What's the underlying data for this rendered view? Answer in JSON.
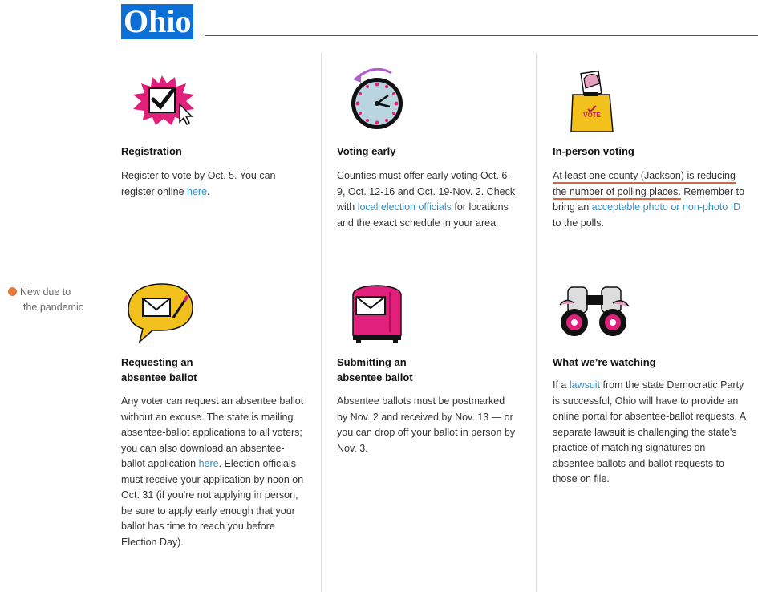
{
  "page": {
    "title": "Ohio"
  },
  "legend": {
    "line1": "New due to",
    "line2": "the pandemic",
    "dot_color": "#e87a3f",
    "icon": "orange-dot-icon"
  },
  "colors": {
    "title_bg": "#0b6fd6",
    "link": "#2f8fc6",
    "underline": "#e0603a",
    "pink": "#e0207a",
    "yellow": "#f3c11e"
  },
  "cards": {
    "registration": {
      "icon": "checkmark-starburst-icon",
      "heading": "Registration",
      "text1": "Register to vote by Oct. 5. You can register online ",
      "link": "here",
      "text2": "."
    },
    "early": {
      "icon": "clock-icon",
      "heading": "Voting early",
      "text1": "Counties must offer early voting Oct. 6-9, Oct. 12-16 and Oct. 19-Nov. 2. Check with ",
      "link": "local election officials",
      "text2": " for locations and the exact schedule in your area."
    },
    "inperson": {
      "icon": "ballot-box-icon",
      "heading": "In-person voting",
      "underlined": "At least one county (Jackson) is reducing the number of polling places.",
      "text1": " Remember to bring an ",
      "link": "acceptable photo or non-photo ID",
      "text2": " to the polls."
    },
    "requesting": {
      "icon": "envelope-speech-bubble-icon",
      "heading_line1": "Requesting an",
      "heading_line2": "absentee ballot",
      "text1": "Any voter can request an absentee ballot without an excuse. The state is mailing absentee-ballot applications to all voters; you can also download an absentee-ballot application ",
      "link": "here",
      "text2": ". Election officials must receive your application by noon on Oct. 31 (if you're not applying in person, be sure to apply early enough that your ballot has time to reach you before Election Day)."
    },
    "submitting": {
      "icon": "mailbox-icon",
      "heading_line1": "Submitting an",
      "heading_line2": "absentee ballot",
      "text": "Absentee ballots must be postmarked by Nov. 2 and received by Nov. 13 — or you can drop off your ballot in person by Nov. 3."
    },
    "watching": {
      "icon": "binoculars-icon",
      "heading": "What we’re watching",
      "text1": "If a ",
      "link": "lawsuit",
      "text2": " from the state Democratic Party is successful, Ohio will have to provide an online portal for absentee-ballot requests. A separate lawsuit is challenging the state's practice of matching signatures on absentee ballots and ballot requests to those on file."
    }
  }
}
